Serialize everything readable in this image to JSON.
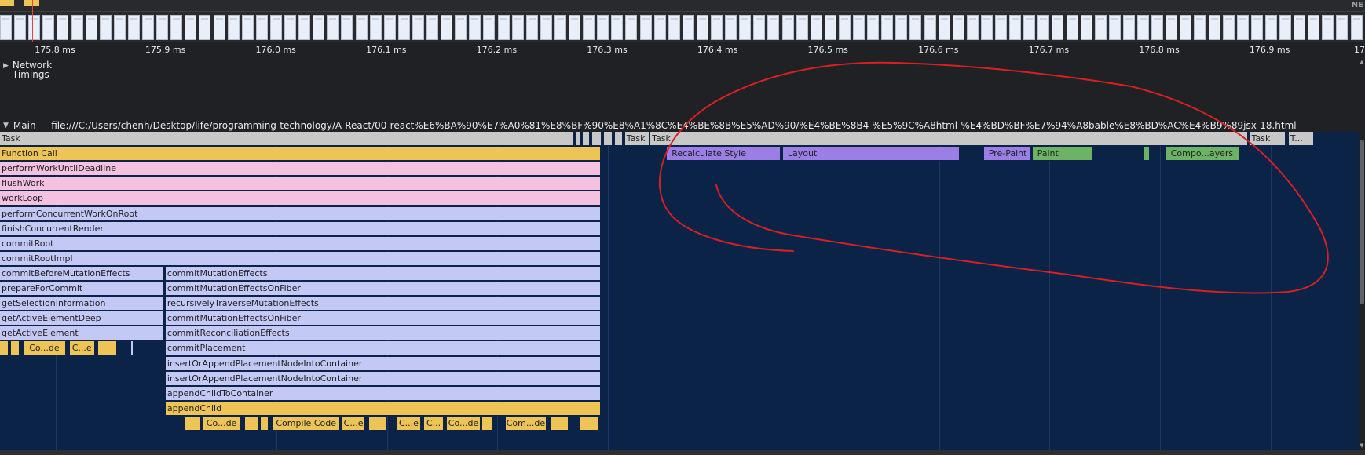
{
  "overview": {
    "corner_label": "NE",
    "screenshot_thumbnails": 96
  },
  "ruler": {
    "ticks": [
      "175.8 ms",
      "175.9 ms",
      "176.0 ms",
      "176.1 ms",
      "176.2 ms",
      "176.3 ms",
      "176.4 ms",
      "176.5 ms",
      "176.6 ms",
      "176.7 ms",
      "176.8 ms",
      "176.9 ms",
      "17"
    ]
  },
  "network": {
    "title_line1": "Network",
    "title_line2": "Timings"
  },
  "main": {
    "title": "Main — file:///C:/Users/chenh/Desktop/life/programming-technology/A-React/00-react%E6%BA%90%E7%A0%81%E8%BF%90%E8%A1%8C%E4%BE%8B%E5%AD%90/%E4%BE%8B4-%E5%9C%A8html-%E4%BD%BF%E7%94%A8bable%E8%BD%AC%E4%B9%89jsx-18.html"
  },
  "colors": {
    "task": "#c8c8c8",
    "script_yellow": "#efc456",
    "pink": "#f4c2e0",
    "lavender": "#c3c8f4",
    "rendering_purple": "#9b7fe6",
    "painting_green": "#6cb463",
    "annotation_red": "#d92020"
  },
  "flame": [
    {
      "label": "Task",
      "row": 0,
      "color": "task",
      "s": "175.800",
      "e": "176.320"
    },
    {
      "label": "",
      "row": 0,
      "color": "task",
      "s": "176.321",
      "e": "176.326"
    },
    {
      "label": "",
      "row": 0,
      "color": "task",
      "s": "176.328",
      "e": "176.334"
    },
    {
      "label": "",
      "row": 0,
      "color": "task",
      "s": "176.336",
      "e": "176.345"
    },
    {
      "label": "",
      "row": 0,
      "color": "task",
      "s": "176.347",
      "e": "176.355"
    },
    {
      "label": "",
      "row": 0,
      "color": "task",
      "s": "176.357",
      "e": "176.364"
    },
    {
      "label": "Task",
      "row": 0,
      "color": "task",
      "s": "176.366",
      "e": "176.388"
    },
    {
      "label": "Task",
      "row": 0,
      "color": "task",
      "s": "176.389",
      "e": "176.930"
    },
    {
      "label": "Task",
      "row": 0,
      "color": "task",
      "s": "176.932",
      "e": "176.964"
    },
    {
      "label": "T...",
      "row": 0,
      "color": "task",
      "s": "176.967",
      "e": "176.990"
    },
    {
      "label": "Function Call",
      "row": 1,
      "color": "script_yellow",
      "s": "175.800",
      "e": "176.344"
    },
    {
      "label": "Recalculate Style",
      "row": 1,
      "color": "rendering_purple",
      "s": "176.404",
      "e": "176.507"
    },
    {
      "label": "Layout",
      "row": 1,
      "color": "rendering_purple",
      "s": "176.509",
      "e": "176.669"
    },
    {
      "label": "Pre-Paint",
      "row": 1,
      "color": "rendering_purple",
      "s": "176.691",
      "e": "176.733"
    },
    {
      "label": "Paint",
      "row": 1,
      "color": "painting_green",
      "s": "176.735",
      "e": "176.790"
    },
    {
      "label": "",
      "row": 1,
      "color": "painting_green",
      "s": "176.836",
      "e": "176.838"
    },
    {
      "label": "Compo...ayers",
      "row": 1,
      "color": "painting_green",
      "s": "176.856",
      "e": "176.922"
    },
    {
      "label": "performWorkUntilDeadline",
      "row": 2,
      "color": "pink",
      "s": "175.800",
      "e": "176.344"
    },
    {
      "label": "flushWork",
      "row": 3,
      "color": "pink",
      "s": "175.800",
      "e": "176.344"
    },
    {
      "label": "workLoop",
      "row": 4,
      "color": "pink",
      "s": "175.800",
      "e": "176.344"
    },
    {
      "label": "performConcurrentWorkOnRoot",
      "row": 5,
      "color": "lavender",
      "s": "175.800",
      "e": "176.344"
    },
    {
      "label": "finishConcurrentRender",
      "row": 6,
      "color": "lavender",
      "s": "175.800",
      "e": "176.344"
    },
    {
      "label": "commitRoot",
      "row": 7,
      "color": "lavender",
      "s": "175.800",
      "e": "176.344"
    },
    {
      "label": "commitRootImpl",
      "row": 8,
      "color": "lavender",
      "s": "175.800",
      "e": "176.344"
    },
    {
      "label": "commitBeforeMutationEffects",
      "row": 9,
      "color": "lavender",
      "s": "175.800",
      "e": "175.949"
    },
    {
      "label": "commitMutationEffects",
      "row": 9,
      "color": "lavender",
      "s": "175.950",
      "e": "176.344"
    },
    {
      "label": "prepareForCommit",
      "row": 10,
      "color": "lavender",
      "s": "175.800",
      "e": "175.949"
    },
    {
      "label": "commitMutationEffectsOnFiber",
      "row": 10,
      "color": "lavender",
      "s": "175.950",
      "e": "176.344"
    },
    {
      "label": "getSelectionInformation",
      "row": 11,
      "color": "lavender",
      "s": "175.800",
      "e": "175.949"
    },
    {
      "label": "recursivelyTraverseMutationEffects",
      "row": 11,
      "color": "lavender",
      "s": "175.950",
      "e": "176.344"
    },
    {
      "label": "getActiveElementDeep",
      "row": 12,
      "color": "lavender",
      "s": "175.800",
      "e": "175.949"
    },
    {
      "label": "commitMutationEffectsOnFiber",
      "row": 12,
      "color": "lavender",
      "s": "175.950",
      "e": "176.344"
    },
    {
      "label": "getActiveElement",
      "row": 13,
      "color": "lavender",
      "s": "175.800",
      "e": "175.949"
    },
    {
      "label": "commitReconciliationEffects",
      "row": 13,
      "color": "lavender",
      "s": "175.950",
      "e": "176.344"
    },
    {
      "label": "",
      "row": 14,
      "color": "script_yellow",
      "s": "175.800",
      "e": "175.808"
    },
    {
      "label": "",
      "row": 14,
      "color": "script_yellow",
      "s": "175.810",
      "e": "175.818"
    },
    {
      "label": "Co...de",
      "row": 14,
      "color": "script_yellow",
      "s": "175.821",
      "e": "175.860",
      "center": true
    },
    {
      "label": "C...e",
      "row": 14,
      "color": "script_yellow",
      "s": "175.863",
      "e": "175.886",
      "center": true
    },
    {
      "label": "",
      "row": 14,
      "color": "script_yellow",
      "s": "175.889",
      "e": "175.906"
    },
    {
      "label": "",
      "row": 14,
      "color": "lavender",
      "s": "175.919",
      "e": "175.920"
    },
    {
      "label": "commitPlacement",
      "row": 14,
      "color": "lavender",
      "s": "175.950",
      "e": "176.344"
    },
    {
      "label": "insertOrAppendPlacementNodeIntoContainer",
      "row": 15,
      "color": "lavender",
      "s": "175.950",
      "e": "176.344"
    },
    {
      "label": "insertOrAppendPlacementNodeIntoContainer",
      "row": 16,
      "color": "lavender",
      "s": "175.950",
      "e": "176.344"
    },
    {
      "label": "appendChildToContainer",
      "row": 17,
      "color": "lavender",
      "s": "175.950",
      "e": "176.344"
    },
    {
      "label": "appendChild",
      "row": 18,
      "color": "script_yellow",
      "s": "175.950",
      "e": "176.344"
    },
    {
      "label": "",
      "row": 19,
      "color": "script_yellow",
      "s": "175.968",
      "e": "175.982"
    },
    {
      "label": "Co...de",
      "row": 19,
      "color": "script_yellow",
      "s": "175.984",
      "e": "176.018",
      "center": true
    },
    {
      "label": "",
      "row": 19,
      "color": "script_yellow",
      "s": "176.022",
      "e": "176.034"
    },
    {
      "label": "",
      "row": 19,
      "color": "script_yellow",
      "s": "176.036",
      "e": "176.043"
    },
    {
      "label": "Compile Code",
      "row": 19,
      "color": "script_yellow",
      "s": "176.047",
      "e": "176.108",
      "center": true
    },
    {
      "label": "C...e",
      "row": 19,
      "color": "script_yellow",
      "s": "176.110",
      "e": "176.131",
      "center": true
    },
    {
      "label": "",
      "row": 19,
      "color": "script_yellow",
      "s": "176.134",
      "e": "176.150"
    },
    {
      "label": "C...e",
      "row": 19,
      "color": "script_yellow",
      "s": "176.160",
      "e": "176.181",
      "center": true
    },
    {
      "label": "C...",
      "row": 19,
      "color": "script_yellow",
      "s": "176.184",
      "e": "176.202",
      "center": true
    },
    {
      "label": "Co...de",
      "row": 19,
      "color": "script_yellow",
      "s": "176.205",
      "e": "176.235",
      "center": true
    },
    {
      "label": "",
      "row": 19,
      "color": "script_yellow",
      "s": "176.237",
      "e": "176.247"
    },
    {
      "label": "Com...de",
      "row": 19,
      "color": "script_yellow",
      "s": "176.258",
      "e": "176.295",
      "center": true
    },
    {
      "label": "",
      "row": 19,
      "color": "script_yellow",
      "s": "176.299",
      "e": "176.315"
    },
    {
      "label": "",
      "row": 19,
      "color": "script_yellow",
      "s": "176.325",
      "e": "176.342"
    }
  ]
}
